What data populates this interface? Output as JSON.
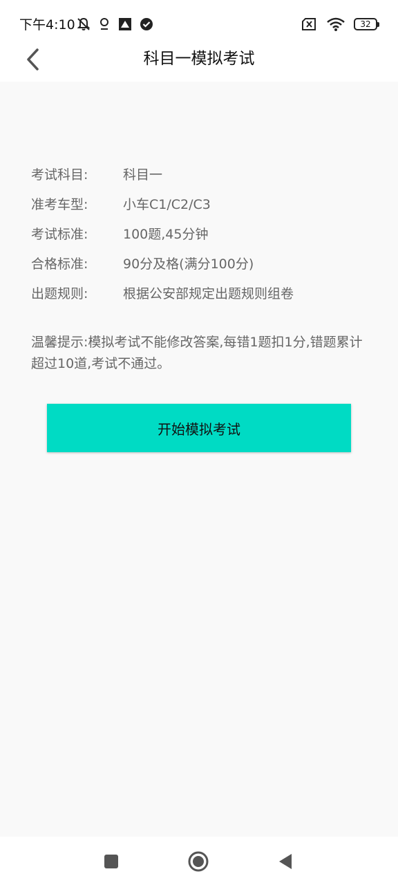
{
  "status_bar": {
    "time": "下午4:10",
    "battery": "32",
    "icons_left": [
      "mute-icon",
      "location-icon",
      "app-icon",
      "check-circle-icon"
    ],
    "icons_right": [
      "sim-off-icon",
      "wifi-icon",
      "battery-icon"
    ]
  },
  "header": {
    "title": "科目一模拟考试"
  },
  "info": {
    "rows": [
      {
        "label": "考试科目:",
        "value": "科目一"
      },
      {
        "label": "准考车型:",
        "value": "小车C1/C2/C3"
      },
      {
        "label": "考试标准:",
        "value": "100题,45分钟"
      },
      {
        "label": "合格标准:",
        "value": "90分及格(满分100分)"
      },
      {
        "label": "出题规则:",
        "value": "根据公安部规定出题规则组卷"
      }
    ]
  },
  "tip": "温馨提示:模拟考试不能修改答案,每错1题扣1分,错题累计超过10道,考试不通过。",
  "start_button_label": "开始模拟考试",
  "colors": {
    "accent": "#00dbc4",
    "background": "#f9f9f9"
  }
}
